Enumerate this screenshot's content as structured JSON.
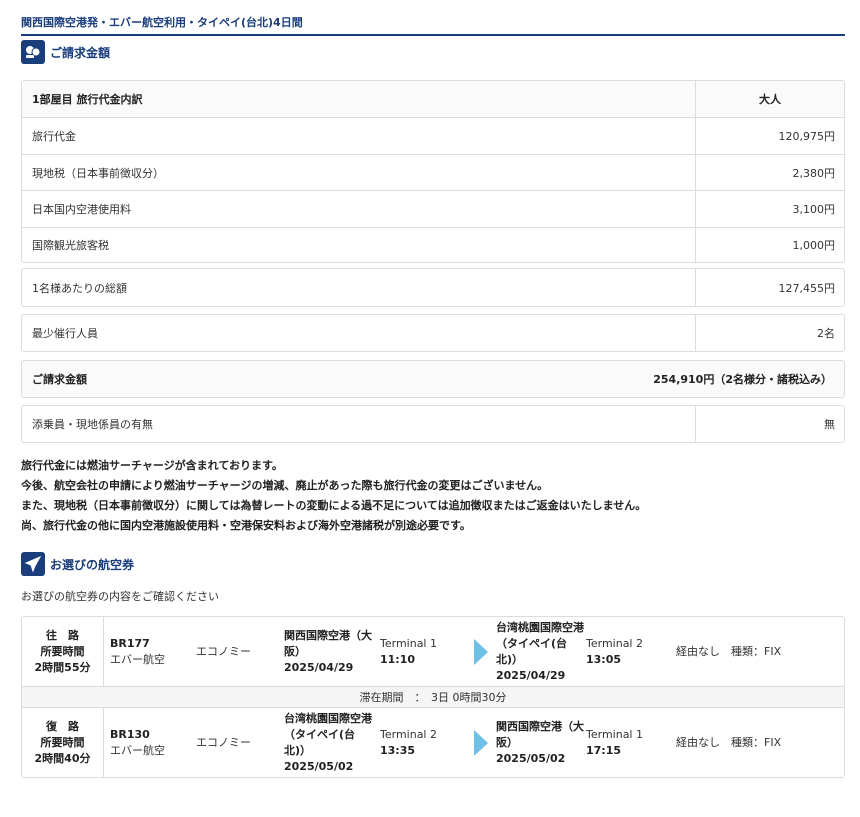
{
  "tour_title": "関西国際空港発・エバー航空利用・タイペイ(台北)4日間",
  "billing": {
    "heading": "ご請求金額",
    "header_label": "1部屋目 旅行代金内訳",
    "header_col": "大人",
    "items": [
      {
        "label": "旅行代金",
        "value": "120,975円"
      },
      {
        "label": "現地税（日本事前徴収分）",
        "value": "2,380円"
      },
      {
        "label": "日本国内空港使用料",
        "value": "3,100円"
      },
      {
        "label": "国際観光旅客税",
        "value": "1,000円"
      }
    ],
    "per_person_label": "1名様あたりの総額",
    "per_person_value": "127,455円",
    "min_people_label": "最少催行人員",
    "min_people_value": "2名",
    "total_label": "ご請求金額",
    "total_value": "254,910円（2名様分・諸税込み）",
    "escort_label": "添乗員・現地係員の有無",
    "escort_value": "無"
  },
  "notes": [
    "旅行代金には燃油サーチャージが含まれております。",
    "今後、航空会社の申請により燃油サーチャージの増減、廃止があった際も旅行代金の変更はございません。",
    "また、現地税（日本事前徴収分）に関しては為替レートの変動による過不足については追加徴収またはご返金はいたしません。",
    "尚、旅行代金の他に国内空港施設使用料・空港保安料および海外空港諸税が別途必要です。"
  ],
  "flights_section": {
    "heading": "お選びの航空券",
    "intro": "お選びの航空券の内容をご確認ください",
    "stay": "滞在期間　：　3日 0時間30分",
    "legs": [
      {
        "dir": "往　路",
        "dur_label": "所要時間",
        "dur": "2時間55分",
        "flight_no": "BR177",
        "airline": "エバー航空",
        "cabin": "エコノミー",
        "dep_airport": "関西国際空港（大阪）",
        "dep_date": "2025/04/29",
        "dep_terminal": "Terminal 1",
        "dep_time": "11:10",
        "arr_airport": "台湾桃園国際空港（タイペイ(台北)）",
        "arr_date": "2025/04/29",
        "arr_terminal": "Terminal 2",
        "arr_time": "13:05",
        "note": "経由なし　種類：FIX"
      },
      {
        "dir": "復　路",
        "dur_label": "所要時間",
        "dur": "2時間40分",
        "flight_no": "BR130",
        "airline": "エバー航空",
        "cabin": "エコノミー",
        "dep_airport": "台湾桃園国際空港（タイペイ(台北)）",
        "dep_date": "2025/05/02",
        "dep_terminal": "Terminal 2",
        "dep_time": "13:35",
        "arr_airport": "関西国際空港（大阪）",
        "arr_date": "2025/05/02",
        "arr_terminal": "Terminal 1",
        "arr_time": "17:15",
        "note": "経由なし　種類：FIX"
      }
    ]
  },
  "colors": {
    "brand": "#1a3d7c",
    "arrow": "#6ec0e6"
  }
}
